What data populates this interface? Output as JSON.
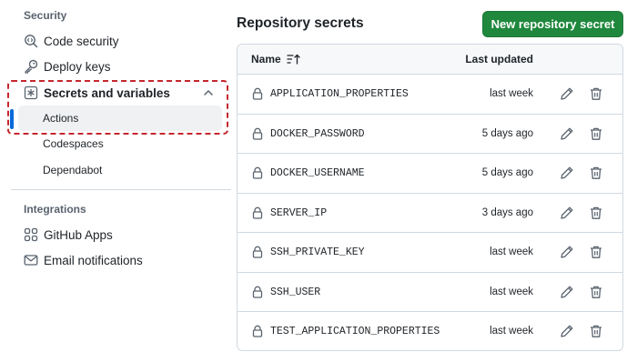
{
  "sidebar": {
    "security_heading": "Security",
    "items": [
      {
        "label": "Code security",
        "icon": "codescan-icon"
      },
      {
        "label": "Deploy keys",
        "icon": "key-icon"
      },
      {
        "label": "Secrets and variables",
        "icon": "asterisk-icon"
      }
    ],
    "sub_items": [
      {
        "label": "Actions",
        "active": true
      },
      {
        "label": "Codespaces",
        "active": false
      },
      {
        "label": "Dependabot",
        "active": false
      }
    ],
    "integrations_heading": "Integrations",
    "integrations": [
      {
        "label": "GitHub Apps",
        "icon": "apps-icon"
      },
      {
        "label": "Email notifications",
        "icon": "mail-icon"
      }
    ]
  },
  "main": {
    "title": "Repository secrets",
    "new_button": "New repository secret",
    "table": {
      "col_name": "Name",
      "col_updated": "Last updated",
      "rows": [
        {
          "name": "APPLICATION_PROPERTIES",
          "updated": "last week"
        },
        {
          "name": "DOCKER_PASSWORD",
          "updated": "5 days ago"
        },
        {
          "name": "DOCKER_USERNAME",
          "updated": "5 days ago"
        },
        {
          "name": "SERVER_IP",
          "updated": "3 days ago"
        },
        {
          "name": "SSH_PRIVATE_KEY",
          "updated": "last week"
        },
        {
          "name": "SSH_USER",
          "updated": "last week"
        },
        {
          "name": "TEST_APPLICATION_PROPERTIES",
          "updated": "last week"
        }
      ]
    }
  },
  "colors": {
    "accent": "#1f883d",
    "active_indicator": "#0969da",
    "highlight": "#c4262d"
  }
}
